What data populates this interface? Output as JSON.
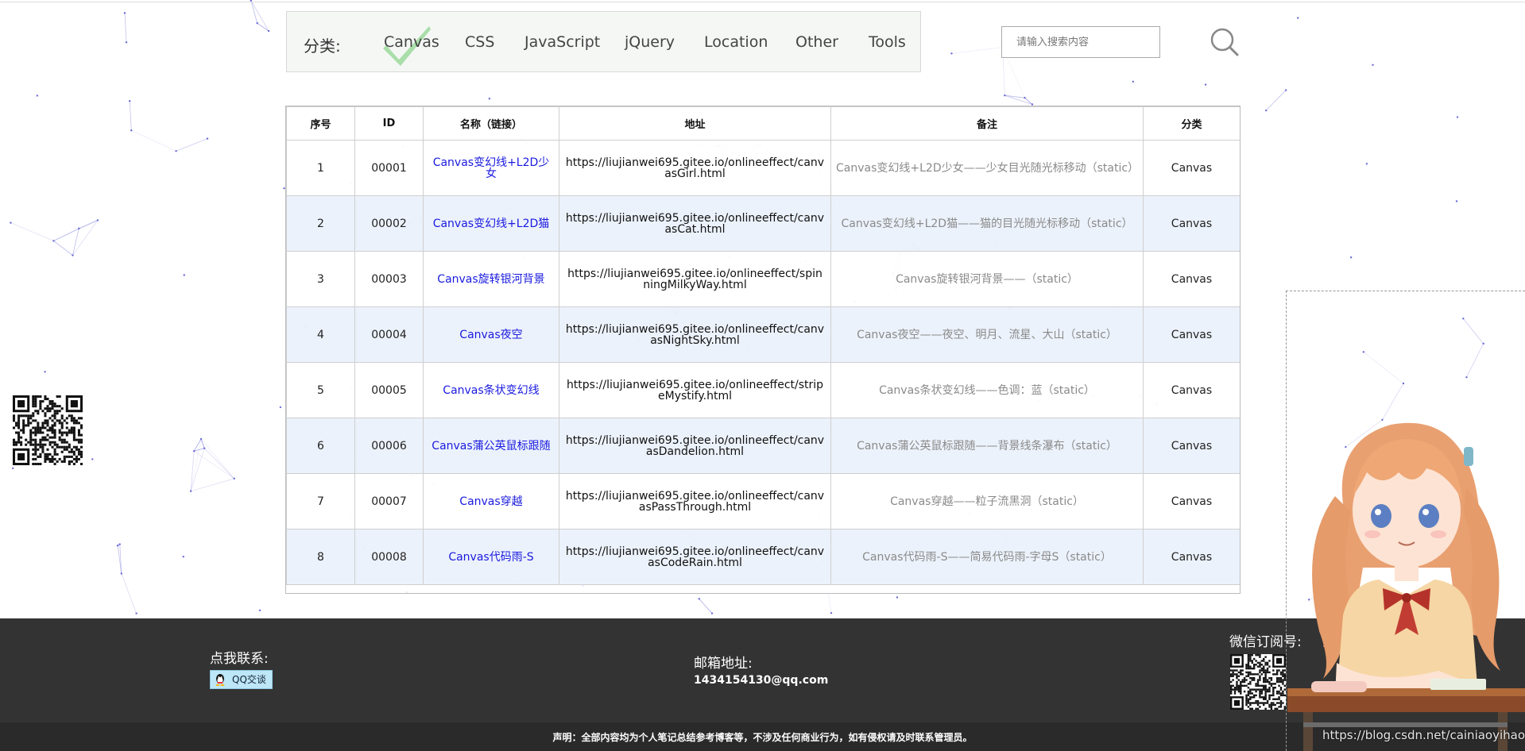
{
  "nav": {
    "label": "分类:",
    "items": [
      "Canvas",
      "CSS",
      "JavaScript",
      "jQuery",
      "Location",
      "Other",
      "Tools"
    ],
    "active": "Canvas"
  },
  "search": {
    "placeholder": "请输入搜索内容"
  },
  "table": {
    "headers": [
      "序号",
      "ID",
      "名称（链接）",
      "地址",
      "备注",
      "分类"
    ],
    "rows": [
      {
        "num": "1",
        "id": "00001",
        "name": "Canvas变幻线+L2D少女",
        "addr": "https://liujianwei695.gitee.io/onlineeffect/canvasGirl.html",
        "note": "Canvas变幻线+L2D少女——少女目光随光标移动（static）",
        "cat": "Canvas"
      },
      {
        "num": "2",
        "id": "00002",
        "name": "Canvas变幻线+L2D猫",
        "addr": "https://liujianwei695.gitee.io/onlineeffect/canvasCat.html",
        "note": "Canvas变幻线+L2D猫——猫的目光随光标移动（static）",
        "cat": "Canvas"
      },
      {
        "num": "3",
        "id": "00003",
        "name": "Canvas旋转银河背景",
        "addr": "https://liujianwei695.gitee.io/onlineeffect/spinningMilkyWay.html",
        "note": "Canvas旋转银河背景——（static）",
        "cat": "Canvas"
      },
      {
        "num": "4",
        "id": "00004",
        "name": "Canvas夜空",
        "addr": "https://liujianwei695.gitee.io/onlineeffect/canvasNightSky.html",
        "note": "Canvas夜空——夜空、明月、流星、大山（static）",
        "cat": "Canvas"
      },
      {
        "num": "5",
        "id": "00005",
        "name": "Canvas条状变幻线",
        "addr": "https://liujianwei695.gitee.io/onlineeffect/stripeMystify.html",
        "note": "Canvas条状变幻线——色调：蓝（static）",
        "cat": "Canvas"
      },
      {
        "num": "6",
        "id": "00006",
        "name": "Canvas蒲公英鼠标跟随",
        "addr": "https://liujianwei695.gitee.io/onlineeffect/canvasDandelion.html",
        "note": "Canvas蒲公英鼠标跟随——背景线条瀑布（static）",
        "cat": "Canvas"
      },
      {
        "num": "7",
        "id": "00007",
        "name": "Canvas穿越",
        "addr": "https://liujianwei695.gitee.io/onlineeffect/canvasPassThrough.html",
        "note": "Canvas穿越——粒子流黑洞（static）",
        "cat": "Canvas"
      },
      {
        "num": "8",
        "id": "00008",
        "name": "Canvas代码雨-S",
        "addr": "https://liujianwei695.gitee.io/onlineeffect/canvasCodeRain.html",
        "note": "Canvas代码雨-S——简易代码雨-字母S（static）",
        "cat": "Canvas"
      }
    ]
  },
  "footer": {
    "contact_label": "点我联系:",
    "qq_button": "QQ交谈",
    "mail_label": "邮箱地址:",
    "mail": "1434154130@qq.com",
    "wechat_label": "微信订阅号:",
    "disclaimer": "声明：全部内容均为个人笔记总结参考博客等，不涉及任何商业行为，如有侵权请及时联系管理员。"
  },
  "watermark": "https://blog.csdn.net/cainiaoyihao_",
  "colors": {
    "link": "#1a1adf",
    "footer_bg": "#333333",
    "row_alt": "#e6eefa",
    "check_green": "#7fcf7f"
  }
}
